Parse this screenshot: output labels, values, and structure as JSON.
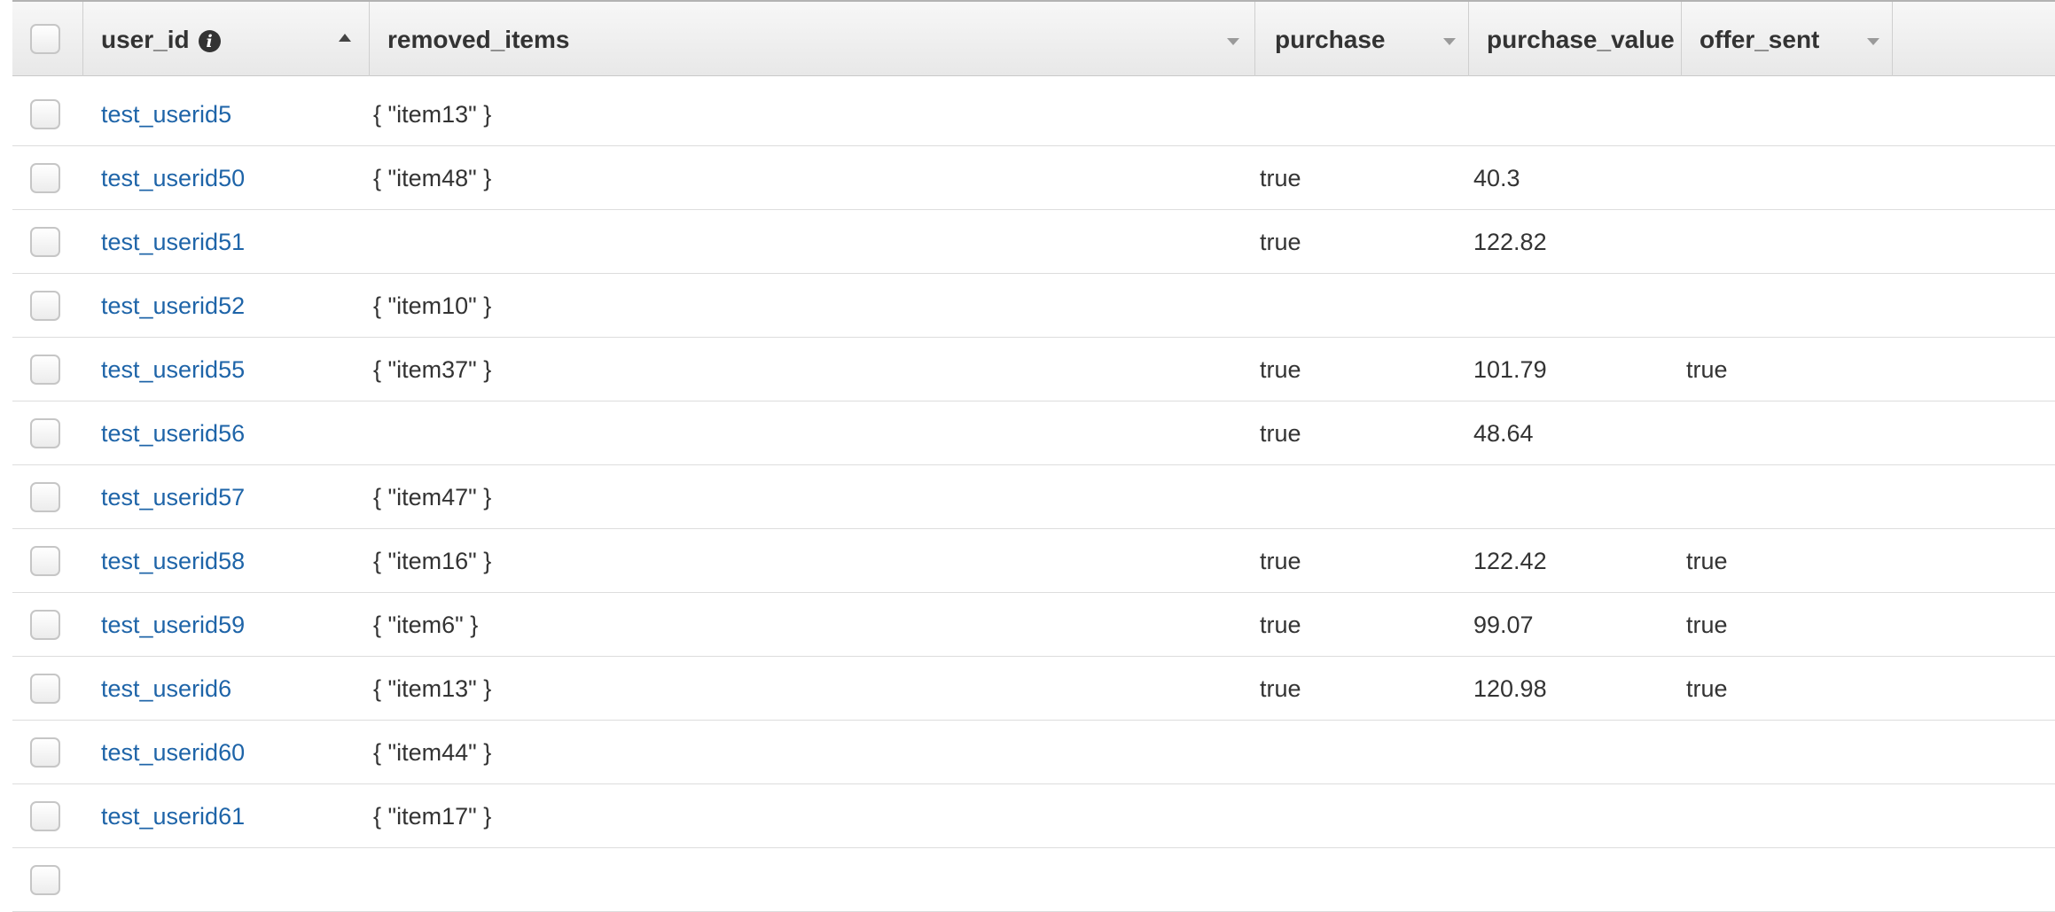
{
  "columns": {
    "user_id": "user_id",
    "removed_items": "removed_items",
    "purchase": "purchase",
    "purchase_value": "purchase_value",
    "offer_sent": "offer_sent"
  },
  "icons": {
    "info": "info-circle-icon",
    "sort": "sort-ascending-icon",
    "dropdown": "chevron-down-icon"
  },
  "info_glyph": "i",
  "link_color": "#1e64a8",
  "rows": [
    {
      "user_id": "test_userid5",
      "removed_items": "{ \"item13\" }",
      "purchase": "",
      "purchase_value": "",
      "offer_sent": ""
    },
    {
      "user_id": "test_userid50",
      "removed_items": "{ \"item48\" }",
      "purchase": "true",
      "purchase_value": "40.3",
      "offer_sent": ""
    },
    {
      "user_id": "test_userid51",
      "removed_items": "",
      "purchase": "true",
      "purchase_value": "122.82",
      "offer_sent": ""
    },
    {
      "user_id": "test_userid52",
      "removed_items": "{ \"item10\" }",
      "purchase": "",
      "purchase_value": "",
      "offer_sent": ""
    },
    {
      "user_id": "test_userid55",
      "removed_items": "{ \"item37\" }",
      "purchase": "true",
      "purchase_value": "101.79",
      "offer_sent": "true"
    },
    {
      "user_id": "test_userid56",
      "removed_items": "",
      "purchase": "true",
      "purchase_value": "48.64",
      "offer_sent": ""
    },
    {
      "user_id": "test_userid57",
      "removed_items": "{ \"item47\" }",
      "purchase": "",
      "purchase_value": "",
      "offer_sent": ""
    },
    {
      "user_id": "test_userid58",
      "removed_items": "{ \"item16\" }",
      "purchase": "true",
      "purchase_value": "122.42",
      "offer_sent": "true"
    },
    {
      "user_id": "test_userid59",
      "removed_items": "{ \"item6\" }",
      "purchase": "true",
      "purchase_value": "99.07",
      "offer_sent": "true"
    },
    {
      "user_id": "test_userid6",
      "removed_items": "{ \"item13\" }",
      "purchase": "true",
      "purchase_value": "120.98",
      "offer_sent": "true"
    },
    {
      "user_id": "test_userid60",
      "removed_items": "{ \"item44\" }",
      "purchase": "",
      "purchase_value": "",
      "offer_sent": ""
    },
    {
      "user_id": "test_userid61",
      "removed_items": "{ \"item17\" }",
      "purchase": "",
      "purchase_value": "",
      "offer_sent": ""
    }
  ]
}
